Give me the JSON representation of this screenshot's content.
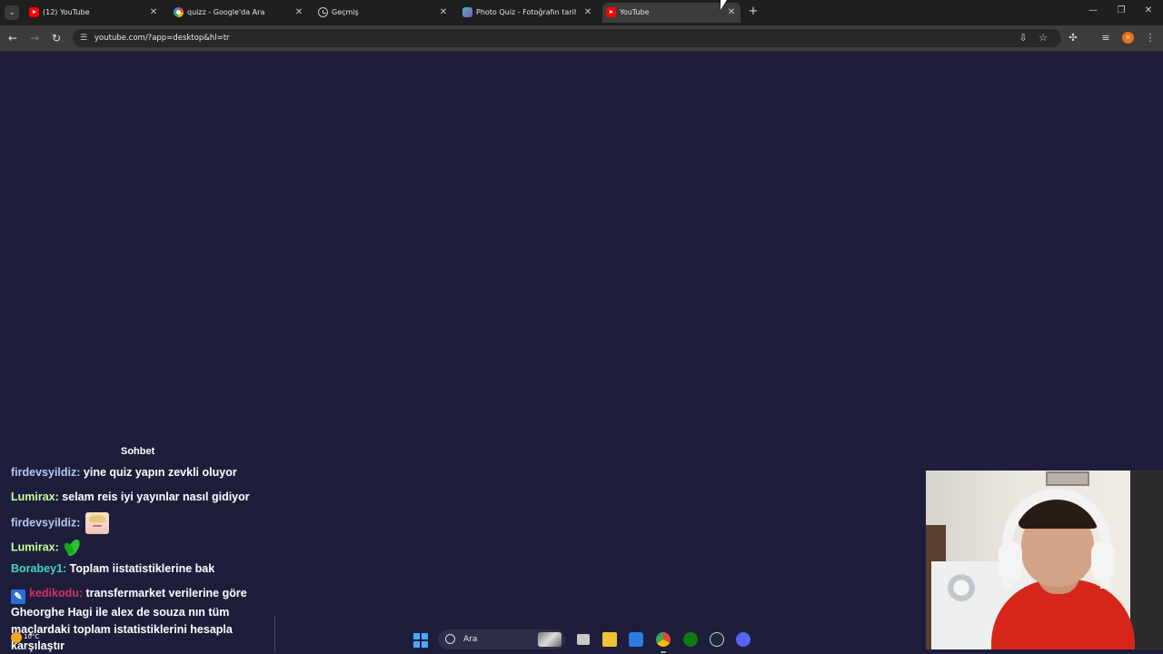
{
  "browser": {
    "tabs": [
      {
        "title": "(12) YouTube",
        "favicon": "youtube-icon",
        "active": false
      },
      {
        "title": "quizz - Google'da Ara",
        "favicon": "google-icon",
        "active": false
      },
      {
        "title": "Geçmiş",
        "favicon": "history-icon",
        "active": false
      },
      {
        "title": "Photo Quiz - Fotoğrafın tarihini",
        "favicon": "photo-quiz-icon",
        "active": false
      },
      {
        "title": "YouTube",
        "favicon": "youtube-icon",
        "active": true
      }
    ],
    "url": "youtube.com/?app=desktop&hl=tr",
    "profile_initial": "n"
  },
  "chat": {
    "title": "Sohbet",
    "messages": [
      {
        "user": "firdevsyildiz",
        "text": " yine quiz yapın zevkli oluyor"
      },
      {
        "user": "Lumirax",
        "text": " selam reis iyi yayınlar nasıl gidiyor"
      },
      {
        "user": "firdevsyildiz",
        "text": "",
        "emote": "anime-girl-emote"
      },
      {
        "user": "Lumirax",
        "text": "",
        "emote": "green-leaf-emote"
      },
      {
        "user": "Borabey1",
        "text": " Toplam iistatistiklerine bak"
      },
      {
        "user": "kedikodu",
        "text": " transfermarket verilerine göre Gheorghe Hagi ile alex de souza nın tüm maçlardaki toplam istatistiklerini hesapla karşılaştır"
      }
    ]
  },
  "taskbar": {
    "search_placeholder": "Ara",
    "weather_temp": "10°C",
    "apps": [
      "start-icon",
      "search-icon",
      "task-view-icon",
      "file-explorer-icon",
      "microsoft-store-icon",
      "chrome-icon",
      "xbox-icon",
      "steam-icon",
      "discord-icon"
    ]
  },
  "colors": {
    "page_bg": "#1e1e3c",
    "user_firdevsyildiz": "#b8c8ee",
    "user_lumirax": "#c6ff99",
    "user_borabey1": "#42d6b9",
    "user_kedikodu": "#d3325c",
    "webcam_shirt": "#d6261c"
  }
}
